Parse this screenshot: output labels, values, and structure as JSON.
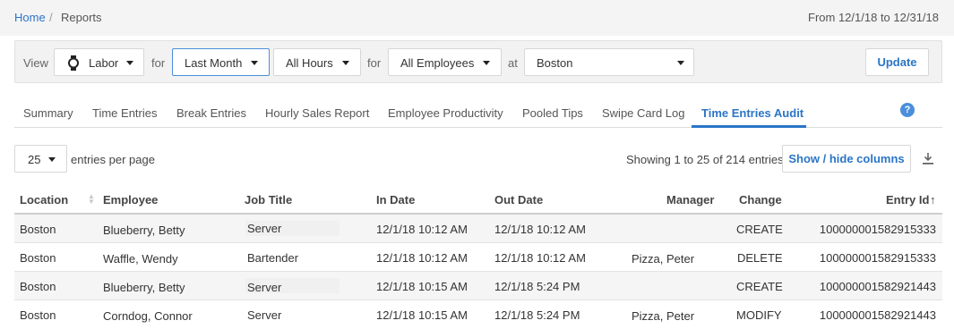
{
  "breadcrumb": {
    "home": "Home",
    "separator": "/",
    "current": "Reports"
  },
  "date_range": "From 12/1/18 to 12/31/18",
  "filters": {
    "view_label": "View",
    "view_value": "Labor",
    "for_label_1": "for",
    "period_value": "Last Month",
    "hours_value": "All Hours",
    "for_label_2": "for",
    "employees_value": "All Employees",
    "at_label": "at",
    "location_value": "Boston",
    "update_label": "Update"
  },
  "tabs": [
    {
      "label": "Summary"
    },
    {
      "label": "Time Entries"
    },
    {
      "label": "Break Entries"
    },
    {
      "label": "Hourly Sales Report"
    },
    {
      "label": "Employee Productivity"
    },
    {
      "label": "Pooled Tips"
    },
    {
      "label": "Swipe Card Log"
    },
    {
      "label": "Time Entries Audit"
    }
  ],
  "active_tab": "Time Entries Audit",
  "help_icon": "question-circle-icon",
  "table_controls": {
    "per_page_value": "25",
    "per_page_label": "entries per page",
    "showing": "Showing 1 to 25 of 214 entries",
    "columns_button": "Show / hide columns",
    "download_icon": "download-icon"
  },
  "table": {
    "columns": [
      "Location",
      "Employee",
      "Job Title",
      "In Date",
      "Out Date",
      "Manager",
      "Change",
      "Entry Id"
    ],
    "sort_indicator": "↑",
    "rows": [
      [
        "Boston",
        "Blueberry, Betty",
        "Server",
        "12/1/18 10:12 AM",
        "12/1/18 10:12 AM",
        "",
        "CREATE",
        "100000001582915333"
      ],
      [
        "Boston",
        "Waffle, Wendy",
        "Bartender",
        "12/1/18 10:12 AM",
        "12/1/18 10:12 AM",
        "Pizza, Peter",
        "DELETE",
        "100000001582915333"
      ],
      [
        "Boston",
        "Blueberry, Betty",
        "Server",
        "12/1/18 10:15 AM",
        "12/1/18 5:24 PM",
        "",
        "CREATE",
        "100000001582921443"
      ],
      [
        "Boston",
        "Corndog, Connor",
        "Server",
        "12/1/18 10:15 AM",
        "12/1/18 5:24 PM",
        "Pizza, Peter",
        "MODIFY",
        "100000001582921443"
      ]
    ]
  },
  "colors": {
    "accent": "#2a75c7",
    "header_bg": "#f4f4f4"
  }
}
